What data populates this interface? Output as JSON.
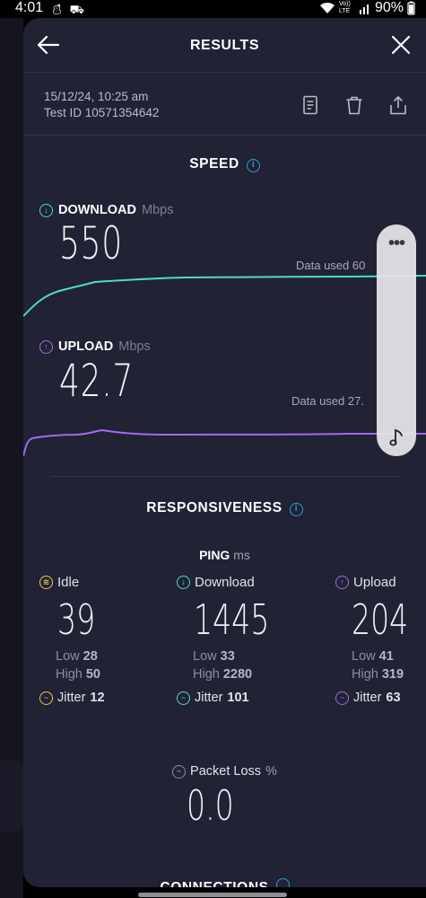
{
  "status_bar": {
    "time": "4:01",
    "left_icons": [
      "notification-icon",
      "notification-icon"
    ],
    "network_label": "Vo)) LTE",
    "battery": "90%"
  },
  "header": {
    "title": "RESULTS",
    "back_icon": "arrow-left-icon",
    "close_icon": "close-icon"
  },
  "test_meta": {
    "datetime": "15/12/24, 10:25 am",
    "test_id": "Test ID 10571354642",
    "actions": [
      "document-icon",
      "trash-icon",
      "share-icon"
    ]
  },
  "speed": {
    "section_title": "SPEED",
    "info_icon": "i",
    "download": {
      "label": "DOWNLOAD",
      "unit": "Mbps",
      "value": "550",
      "data_used": "Data used 60",
      "color": "#4dd9d0"
    },
    "upload": {
      "label": "UPLOAD",
      "unit": "Mbps",
      "value": "42.7",
      "data_used": "Data used 27.",
      "color": "#a36bf0"
    }
  },
  "responsiveness": {
    "section_title": "RESPONSIVENESS",
    "info_icon": "i",
    "ping_label": "PING",
    "ping_unit": "ms",
    "columns": [
      {
        "title": "Idle",
        "value": "39",
        "low_label": "Low",
        "low": "28",
        "high_label": "High",
        "high": "50",
        "jitter_label": "Jitter",
        "jitter": "12",
        "color": "#e8c85a"
      },
      {
        "title": "Download",
        "value": "1445",
        "low_label": "Low",
        "low": "33",
        "high_label": "High",
        "high": "2280",
        "jitter_label": "Jitter",
        "jitter": "101",
        "color": "#4dd9d0"
      },
      {
        "title": "Upload",
        "value": "204",
        "low_label": "Low",
        "low": "41",
        "high_label": "High",
        "high": "319",
        "jitter_label": "Jitter",
        "jitter": "63",
        "color": "#a36bf0"
      }
    ],
    "packet_loss": {
      "label": "Packet Loss",
      "unit": "%",
      "value": "0.0"
    }
  },
  "connections": {
    "section_title": "CONNECTIONS"
  },
  "floating_panel": {
    "menu_icon": "more-horizontal-icon",
    "music_icon": "music-note-icon"
  },
  "colors": {
    "background": "#212233",
    "accent_info": "#2f9bdc"
  }
}
